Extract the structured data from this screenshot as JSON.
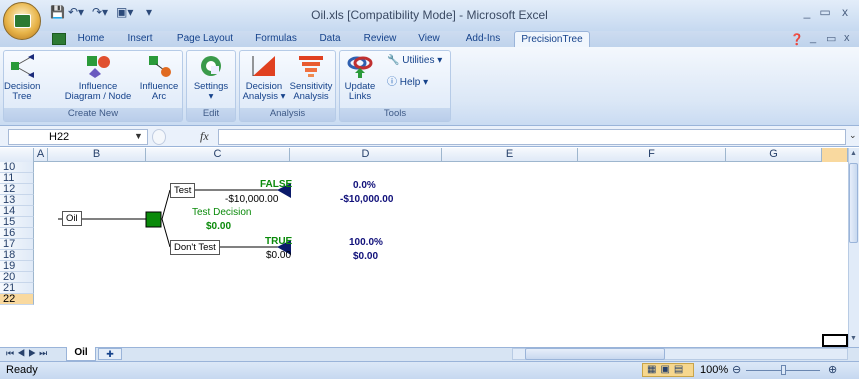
{
  "window": {
    "title": "Oil.xls  [Compatibility Mode] - Microsoft Excel",
    "controls": [
      "_",
      "▭",
      "x"
    ],
    "doc_controls": [
      "_",
      "▭",
      "x"
    ]
  },
  "tabs": [
    "Home",
    "Insert",
    "Page Layout",
    "Formulas",
    "Data",
    "Review",
    "View",
    "Add-Ins",
    "PrecisionTree"
  ],
  "active_tab": "PrecisionTree",
  "ribbon": {
    "groups": [
      {
        "label": "Create New",
        "buttons": [
          {
            "l1": "Decision",
            "l2": "Tree",
            "icon": "decision-tree-icon"
          },
          {
            "l1": "Influence",
            "l2": "Diagram / Node",
            "icon": "influence-diagram-icon"
          },
          {
            "l1": "Influence",
            "l2": "Arc",
            "icon": "influence-arc-icon"
          }
        ]
      },
      {
        "label": "Edit",
        "buttons": [
          {
            "l1": "Settings",
            "l2": "▾",
            "icon": "settings-icon"
          }
        ]
      },
      {
        "label": "Analysis",
        "buttons": [
          {
            "l1": "Decision",
            "l2": "Analysis ▾",
            "icon": "decision-analysis-icon"
          },
          {
            "l1": "Sensitivity",
            "l2": "Analysis",
            "icon": "sensitivity-analysis-icon"
          }
        ]
      },
      {
        "label": "Tools",
        "buttons": [
          {
            "l1": "Update",
            "l2": "Links",
            "icon": "update-links-icon"
          }
        ],
        "small": [
          "Utilities ▾",
          "Help ▾"
        ]
      }
    ]
  },
  "formula_bar": {
    "name_box": "H22",
    "fx": "fx",
    "formula": ""
  },
  "columns": [
    "A",
    "B",
    "C",
    "D",
    "E",
    "F",
    "G"
  ],
  "rows": [
    "10",
    "11",
    "12",
    "13",
    "14",
    "15",
    "16",
    "17",
    "18",
    "19",
    "20",
    "21",
    "22"
  ],
  "tree": {
    "root_label": "Oil",
    "decision_label": "Test Decision",
    "decision_value": "$0.00",
    "branch_top": {
      "name": "Test",
      "flag": "FALSE",
      "value": "-$10,000.00",
      "prob": "0.0%",
      "payoff": "-$10,000.00"
    },
    "branch_bottom": {
      "name": "Don't Test",
      "flag": "TRUE",
      "value": "$0.00",
      "prob": "100.0%",
      "payoff": "$0.00"
    }
  },
  "sheet_tabs": [
    "Oil"
  ],
  "status": {
    "left": "Ready",
    "zoom": "100%"
  }
}
